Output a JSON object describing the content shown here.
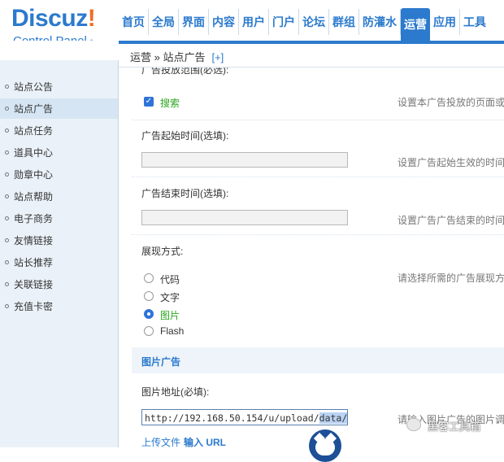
{
  "logo": {
    "main_a": "Discuz",
    "main_b": "!",
    "sub": "Control Panel"
  },
  "topnav": [
    "首页",
    "全局",
    "界面",
    "内容",
    "用户",
    "门户",
    "论坛",
    "群组",
    "防灌水",
    "运营",
    "应用",
    "工具"
  ],
  "active_tab": "运营",
  "breadcrumb": {
    "text": "运营 » 站点广告",
    "plus": "[+]"
  },
  "sidebar": [
    "站点公告",
    "站点广告",
    "站点任务",
    "道具中心",
    "勋章中心",
    "站点帮助",
    "电子商务",
    "友情链接",
    "站长推荐",
    "关联链接",
    "充值卡密"
  ],
  "sidebar_active": "站点广告",
  "form": {
    "partial_label": "广告投放范围(必选):",
    "checkbox_search": {
      "label": "搜索",
      "checked": true
    },
    "scope_desc": "设置本广告投放的页面或",
    "start_label": "广告起始时间(选填):",
    "start_value": "",
    "start_desc": "设置广告起始生效的时间",
    "end_label": "广告结束时间(选填):",
    "end_value": "",
    "end_desc": "设置广告广告结束的时间",
    "display_label": "展现方式:",
    "display_options": [
      "代码",
      "文字",
      "图片",
      "Flash"
    ],
    "display_selected": "图片",
    "display_desc": "请选择所需的广告展现方",
    "section_title": "图片广告",
    "img_url_label": "图片地址(必填):",
    "img_url_value_a": "http://192.168.50.154/u/upload/",
    "img_url_value_sel": "data/att",
    "img_url_desc": "请输入图片广告的图片调",
    "upload_link": "上传文件",
    "input_url_link": "输入 URL"
  },
  "watermark": "黑客工具箱"
}
